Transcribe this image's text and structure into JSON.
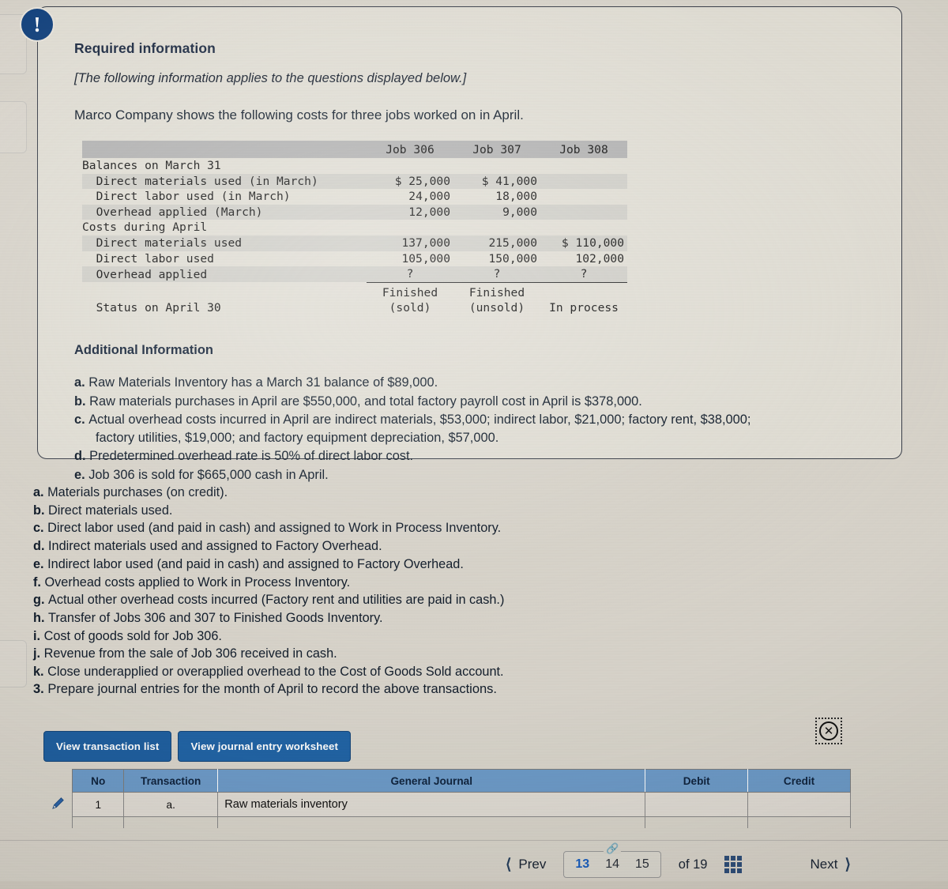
{
  "card": {
    "alert_icon": "exclamation-icon",
    "title": "Required information",
    "note": "[The following information applies to the questions displayed below.]",
    "intro": "Marco Company shows the following costs for three jobs worked on in April."
  },
  "cost_table": {
    "columns": [
      "",
      "Job 306",
      "Job 307",
      "Job 308"
    ],
    "rows": [
      {
        "label": "Balances on March 31",
        "indent": 0,
        "values": [
          "",
          "",
          ""
        ]
      },
      {
        "label": "Direct materials used (in March)",
        "indent": 1,
        "values": [
          "$ 25,000",
          "$ 41,000",
          ""
        ]
      },
      {
        "label": "Direct labor used (in March)",
        "indent": 1,
        "values": [
          "24,000",
          "18,000",
          ""
        ]
      },
      {
        "label": "Overhead applied (March)",
        "indent": 1,
        "values": [
          "12,000",
          "9,000",
          ""
        ]
      },
      {
        "label": "Costs during April",
        "indent": 0,
        "values": [
          "",
          "",
          ""
        ]
      },
      {
        "label": "Direct materials used",
        "indent": 1,
        "values": [
          "137,000",
          "215,000",
          "$ 110,000"
        ]
      },
      {
        "label": "Direct labor used",
        "indent": 1,
        "values": [
          "105,000",
          "150,000",
          "102,000"
        ]
      },
      {
        "label": "Overhead applied",
        "indent": 1,
        "values": [
          "?",
          "?",
          "?"
        ]
      }
    ],
    "status_label": "Status on April 30",
    "status_values": [
      {
        "line1": "Finished",
        "line2": "(sold)"
      },
      {
        "line1": "Finished",
        "line2": "(unsold)"
      },
      {
        "line1": "In process",
        "line2": ""
      }
    ]
  },
  "additional": {
    "heading": "Additional Information",
    "items": [
      {
        "letter": "a.",
        "text": "Raw Materials Inventory has a March 31 balance of $89,000."
      },
      {
        "letter": "b.",
        "text": "Raw materials purchases in April are $550,000, and total factory payroll cost in April is $378,000."
      },
      {
        "letter": "c.",
        "text": "Actual overhead costs incurred in April are indirect materials, $53,000; indirect labor, $21,000; factory rent, $38,000;",
        "cont": "factory utilities, $19,000; and factory equipment depreciation, $57,000."
      },
      {
        "letter": "d.",
        "text": "Predetermined overhead rate is 50% of direct labor cost."
      },
      {
        "letter": "e.",
        "text": "Job 306 is sold for $665,000 cash in April."
      }
    ]
  },
  "transactions": [
    {
      "letter": "a.",
      "text": "Materials purchases (on credit)."
    },
    {
      "letter": "b.",
      "text": "Direct materials used."
    },
    {
      "letter": "c.",
      "text": "Direct labor used (and paid in cash) and assigned to Work in Process Inventory."
    },
    {
      "letter": "d.",
      "text": "Indirect materials used and assigned to Factory Overhead."
    },
    {
      "letter": "e.",
      "text": "Indirect labor used (and paid in cash) and assigned to Factory Overhead."
    },
    {
      "letter": "f.",
      "text": "Overhead costs applied to Work in Process Inventory."
    },
    {
      "letter": "g.",
      "text": "Actual other overhead costs incurred (Factory rent and utilities are paid in cash.)"
    },
    {
      "letter": "h.",
      "text": "Transfer of Jobs 306 and 307 to Finished Goods Inventory."
    },
    {
      "letter": "i.",
      "text": "Cost of goods sold for Job 306."
    },
    {
      "letter": "j.",
      "text": "Revenue from the sale of Job 306 received in cash."
    },
    {
      "letter": "k.",
      "text": "Close underapplied or overapplied overhead to the Cost of Goods Sold account."
    }
  ],
  "question": {
    "number": "3.",
    "text": "Prepare journal entries for the month of April to record the above transactions."
  },
  "buttons": {
    "transaction_list": "View transaction list",
    "journal_worksheet": "View journal entry worksheet",
    "close_icon": "close-x-icon"
  },
  "journal": {
    "headers": [
      "",
      "No",
      "Transaction",
      "General Journal",
      "Debit",
      "Credit"
    ],
    "rows": [
      {
        "edit_icon": "pencil-icon",
        "no": "1",
        "transaction": "a.",
        "general_journal": "Raw materials inventory",
        "debit": "",
        "credit": ""
      }
    ]
  },
  "nav": {
    "prev_label": "Prev",
    "prev_icon": "chevron-left-icon",
    "next_label": "Next",
    "next_icon": "chevron-right-icon",
    "link_icon": "link-chain-icon",
    "pages": [
      "13",
      "14",
      "15"
    ],
    "active_page": "13",
    "of_label": "of 19",
    "grid_icon": "grid-menu-icon"
  }
}
